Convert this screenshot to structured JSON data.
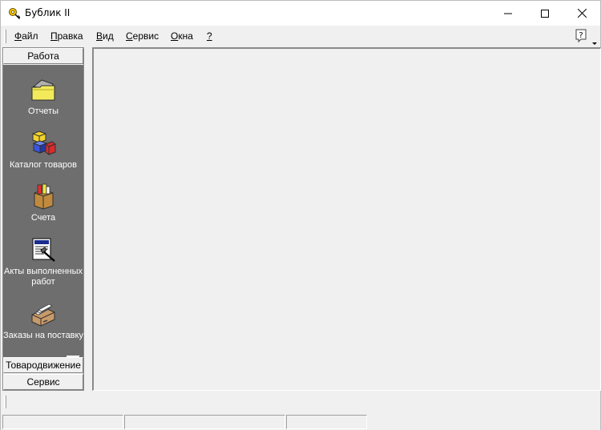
{
  "window": {
    "title": "Бублик II",
    "icon": "app-key-icon",
    "controls": [
      "minimize-icon",
      "maximize-icon",
      "close-icon"
    ]
  },
  "menu": {
    "items": [
      {
        "label": "Файл",
        "accel": "Ф",
        "rest": "айл"
      },
      {
        "label": "Правка",
        "accel": "П",
        "rest": "равка"
      },
      {
        "label": "Вид",
        "accel": "В",
        "rest": "ид"
      },
      {
        "label": "Сервис",
        "accel": "С",
        "rest": "ервис"
      },
      {
        "label": "Окна",
        "accel": "О",
        "rest": "кна"
      },
      {
        "label": "?",
        "accel": "?",
        "rest": ""
      }
    ],
    "help_icon": "help-icon"
  },
  "sidebar": {
    "active_group": "Работа",
    "groups": [
      {
        "label": "Работа"
      },
      {
        "label": "Товародвижение"
      },
      {
        "label": "Сервис"
      }
    ],
    "items": [
      {
        "label": "Отчеты",
        "icon": "folder-icon"
      },
      {
        "label": "Каталог товаров",
        "icon": "cubes-icon"
      },
      {
        "label": "Счета",
        "icon": "box-icon"
      },
      {
        "label": "Акты выполненных работ",
        "icon": "document-hammer-icon"
      },
      {
        "label": "Заказы на поставку",
        "icon": "card-file-icon"
      }
    ]
  },
  "statusbar": {
    "panels": [
      "",
      "",
      ""
    ]
  }
}
